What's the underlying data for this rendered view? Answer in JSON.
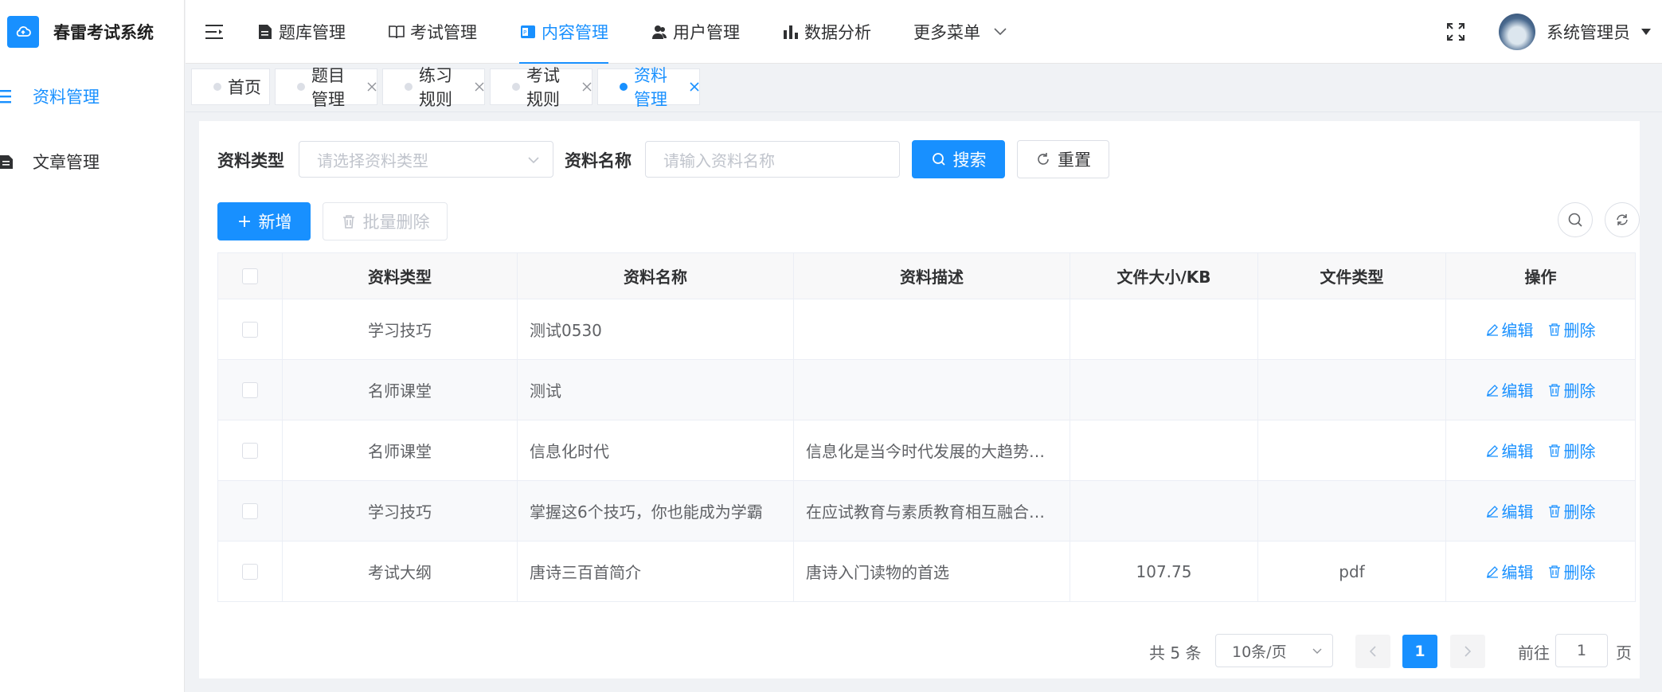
{
  "app": {
    "title": "春雷考试系统"
  },
  "colors": {
    "accent": "#1890ff"
  },
  "sidebar": {
    "items": [
      {
        "label": "资料管理",
        "icon": "list-icon",
        "active": true
      },
      {
        "label": "文章管理",
        "icon": "document-icon",
        "active": false
      }
    ]
  },
  "header": {
    "nav": [
      {
        "label": "题库管理",
        "icon": "document-icon"
      },
      {
        "label": "考试管理",
        "icon": "book-icon"
      },
      {
        "label": "内容管理",
        "icon": "ppt-icon",
        "active": true
      },
      {
        "label": "用户管理",
        "icon": "users-icon"
      },
      {
        "label": "数据分析",
        "icon": "bar-chart-icon"
      },
      {
        "label": "更多菜单",
        "icon": "chevron-down-icon"
      }
    ],
    "user": {
      "name": "系统管理员"
    }
  },
  "tags": [
    {
      "label": "首页",
      "closable": false
    },
    {
      "label": "题目管理",
      "closable": true
    },
    {
      "label": "练习规则",
      "closable": true
    },
    {
      "label": "考试规则",
      "closable": true
    },
    {
      "label": "资料管理",
      "closable": true,
      "active": true
    }
  ],
  "filters": {
    "type_label": "资料类型",
    "type_placeholder": "请选择资料类型",
    "name_label": "资料名称",
    "name_placeholder": "请输入资料名称",
    "search_label": "搜索",
    "reset_label": "重置"
  },
  "toolbar": {
    "add_label": "新增",
    "batch_delete_label": "批量删除"
  },
  "table": {
    "headers": [
      "资料类型",
      "资料名称",
      "资料描述",
      "文件大小/KB",
      "文件类型",
      "操作"
    ],
    "rows": [
      {
        "type": "学习技巧",
        "name": "测试0530",
        "desc": "",
        "size": "",
        "filetype": ""
      },
      {
        "type": "名师课堂",
        "name": "测试",
        "desc": "",
        "size": "",
        "filetype": ""
      },
      {
        "type": "名师课堂",
        "name": "信息化时代",
        "desc": "信息化是当今时代发展的大趋势…",
        "size": "",
        "filetype": ""
      },
      {
        "type": "学习技巧",
        "name": "掌握这6个技巧，你也能成为学霸",
        "desc": "在应试教育与素质教育相互融合…",
        "size": "",
        "filetype": ""
      },
      {
        "type": "考试大纲",
        "name": "唐诗三百首简介",
        "desc": "唐诗入门读物的首选",
        "size": "107.75",
        "filetype": "pdf"
      }
    ],
    "edit_label": "编辑",
    "delete_label": "删除"
  },
  "pagination": {
    "total": "共 5 条",
    "page_size": "10条/页",
    "current": "1",
    "goto_prefix": "前往",
    "goto_value": "1",
    "goto_suffix": "页"
  }
}
